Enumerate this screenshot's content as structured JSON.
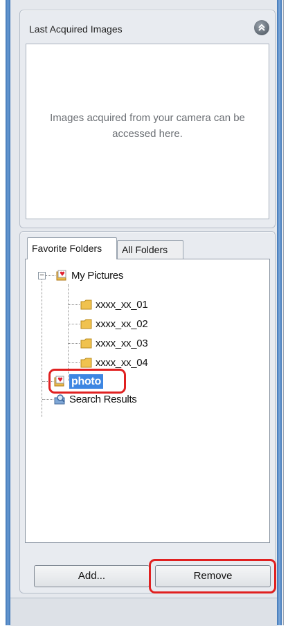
{
  "last_acquired": {
    "title": "Last Acquired Images",
    "message": "Images acquired from your camera can be accessed here.",
    "collapse_icon": "double-chevron-up-icon"
  },
  "tabs": [
    {
      "label": "Favorite Folders",
      "active": true
    },
    {
      "label": "All Folders",
      "active": false
    }
  ],
  "tree": {
    "root": {
      "label": "My Pictures",
      "icon": "favorite-folder-icon",
      "expanded": true
    },
    "children": [
      {
        "label": "xxxx_xx_01",
        "icon": "folder-icon"
      },
      {
        "label": "xxxx_xx_02",
        "icon": "folder-icon"
      },
      {
        "label": "xxxx_xx_03",
        "icon": "folder-icon"
      },
      {
        "label": "xxxx_xx_04",
        "icon": "folder-icon"
      }
    ],
    "favorite": {
      "label": "photo",
      "icon": "favorite-folder-icon",
      "selected": true
    },
    "search": {
      "label": "Search Results",
      "icon": "search-folder-icon"
    }
  },
  "buttons": {
    "add": "Add...",
    "remove": "Remove"
  },
  "colors": {
    "selection": "#3d86e2",
    "highlight": "#e02020",
    "window_accent": "#3d74b6"
  }
}
